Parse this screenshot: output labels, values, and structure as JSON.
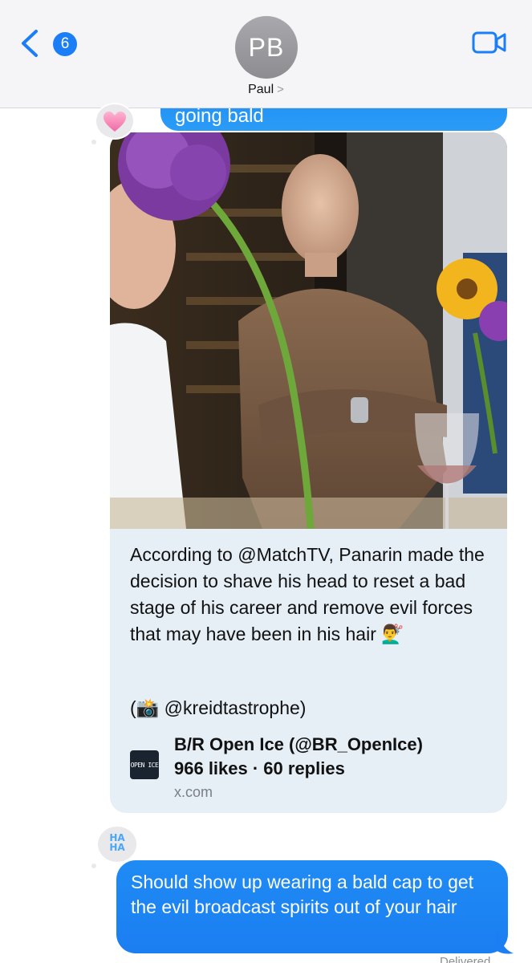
{
  "header": {
    "back_badge_count": "6",
    "contact_initials": "PB",
    "contact_name": "Paul",
    "contact_chevron": ">"
  },
  "messages": {
    "previous_sent_text": "going bald",
    "tapback_1": "heart",
    "link_card": {
      "body": "According to @MatchTV, Panarin made the decision to shave his head to reset a bad stage of his career and remove evil forces that may have been in his hair 💇‍♂️",
      "credit": "(📸 @kreidtastrophe)",
      "source_logo_text": "OPEN ICE",
      "source_name": "B/R Open Ice (@BR_OpenIce)",
      "source_stats": "966 likes · 60 replies",
      "source_domain": "x.com"
    },
    "tapback_2": {
      "line1": "HA",
      "line2": "HA"
    },
    "sent_text": "Should show up wearing a bald cap to get the evil broadcast spirits out of your hair",
    "status": "Delivered"
  },
  "colors": {
    "accent_blue": "#1b7ef7",
    "bubble_gray": "#e6eef6",
    "header_bg": "#f5f5f7"
  }
}
